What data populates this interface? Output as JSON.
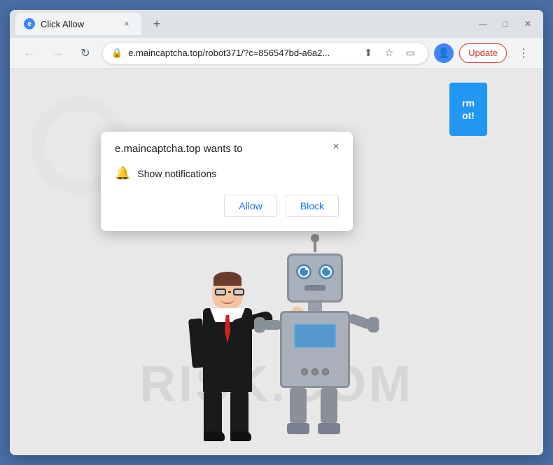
{
  "browser": {
    "title": "Click Allow",
    "tab": {
      "favicon_label": "e",
      "title": "Click Allow",
      "close_label": "×"
    },
    "new_tab_label": "+",
    "window_controls": {
      "minimize": "—",
      "maximize": "□",
      "close": "✕"
    },
    "nav": {
      "back_icon": "←",
      "forward_icon": "→",
      "reload_icon": "↻",
      "lock_icon": "🔒",
      "address": "e.maincaptcha.top/robot371/?c=856547bd-a6a2...",
      "share_icon": "⬆",
      "bookmark_icon": "☆",
      "split_icon": "▭",
      "profile_icon": "👤",
      "update_label": "Update",
      "menu_icon": "⋮"
    }
  },
  "popup": {
    "title": "e.maincaptcha.top wants to",
    "close_icon": "×",
    "notification_icon": "🔔",
    "notification_label": "Show notifications",
    "allow_button": "Allow",
    "block_button": "Block"
  },
  "page": {
    "cta_line1": "rm",
    "cta_line2": "ot!",
    "watermark": "RISK.COM",
    "bg_color": "#e8e8e8"
  }
}
